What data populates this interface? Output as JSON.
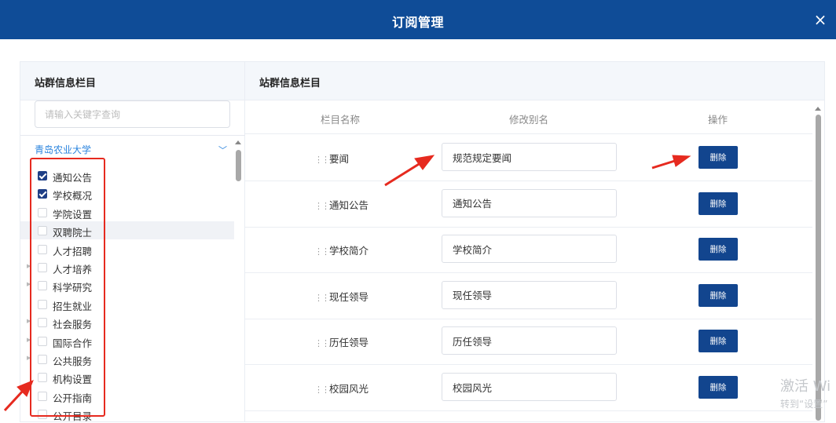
{
  "modal": {
    "title": "订阅管理",
    "close_symbol": "×"
  },
  "left_panel": {
    "title": "站群信息栏目",
    "search_placeholder": "请输入关键字查询",
    "org_name": "青岛农业大学",
    "tree_items": [
      {
        "label": "通知公告",
        "checked": true,
        "expandable": false
      },
      {
        "label": "学校概况",
        "checked": true,
        "expandable": false
      },
      {
        "label": "学院设置",
        "checked": false,
        "expandable": false
      },
      {
        "label": "双聘院士",
        "checked": false,
        "expandable": false,
        "highlighted": true
      },
      {
        "label": "人才招聘",
        "checked": false,
        "expandable": false
      },
      {
        "label": "人才培养",
        "checked": false,
        "expandable": true
      },
      {
        "label": "科学研究",
        "checked": false,
        "expandable": true
      },
      {
        "label": "招生就业",
        "checked": false,
        "expandable": false
      },
      {
        "label": "社会服务",
        "checked": false,
        "expandable": true
      },
      {
        "label": "国际合作",
        "checked": false,
        "expandable": true
      },
      {
        "label": "公共服务",
        "checked": false,
        "expandable": true
      },
      {
        "label": "机构设置",
        "checked": false,
        "expandable": false
      },
      {
        "label": "公开指南",
        "checked": false,
        "expandable": false
      },
      {
        "label": "公开目录",
        "checked": false,
        "expandable": false
      }
    ]
  },
  "right_panel": {
    "title": "站群信息栏目",
    "columns": {
      "name": "栏目名称",
      "alias": "修改别名",
      "action": "操作"
    },
    "delete_label": "删除",
    "rows": [
      {
        "name": "要闻",
        "alias": "规范规定要闻"
      },
      {
        "name": "通知公告",
        "alias": "通知公告"
      },
      {
        "name": "学校简介",
        "alias": "学校简介"
      },
      {
        "name": "现任领导",
        "alias": "现任领导"
      },
      {
        "name": "历任领导",
        "alias": "历任领导"
      },
      {
        "name": "校园风光",
        "alias": "校园风光"
      }
    ]
  },
  "watermark": {
    "line1": "激活 Wi",
    "line2": "转到“设置”"
  },
  "colors": {
    "header": "#0f4c97",
    "button": "#12458e",
    "accent": "#2b84de",
    "annotation": "#e62a1f"
  }
}
